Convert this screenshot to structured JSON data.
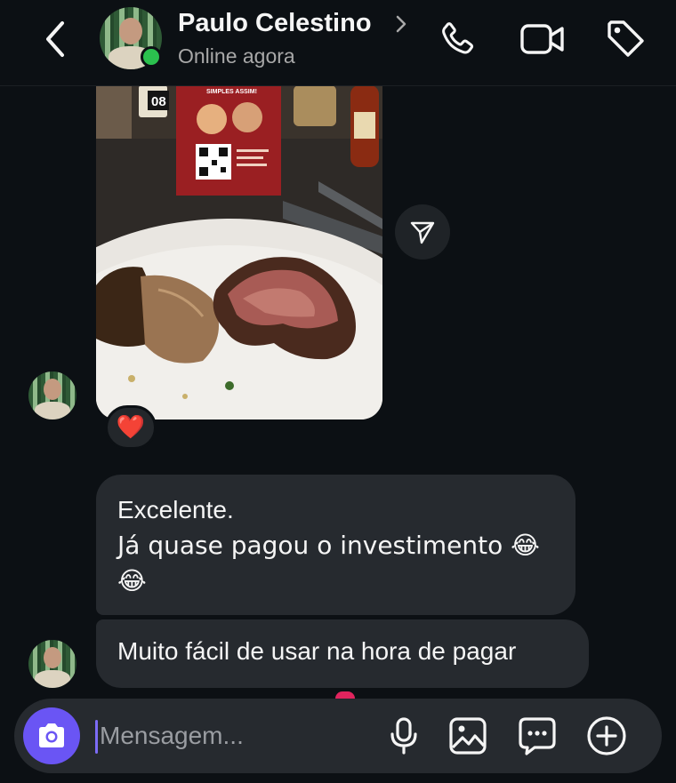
{
  "header": {
    "contact_name": "Paulo Celestino",
    "status": "Online agora"
  },
  "photo_message": {
    "stand_heading": "SIMPLES ASSIM!",
    "counter_number": "08",
    "reaction": "❤️"
  },
  "messages": [
    {
      "lines": [
        "Excelente.",
        "Já quase pagou o investimento 😂",
        "😂"
      ]
    },
    {
      "text": "Muito fácil de usar na hora de pagar"
    }
  ],
  "composer": {
    "placeholder": "Mensagem..."
  },
  "colors": {
    "background": "#0c1014",
    "bubble": "#262a2f",
    "camera_button": "#6a55f4",
    "online": "#2bc14e"
  }
}
